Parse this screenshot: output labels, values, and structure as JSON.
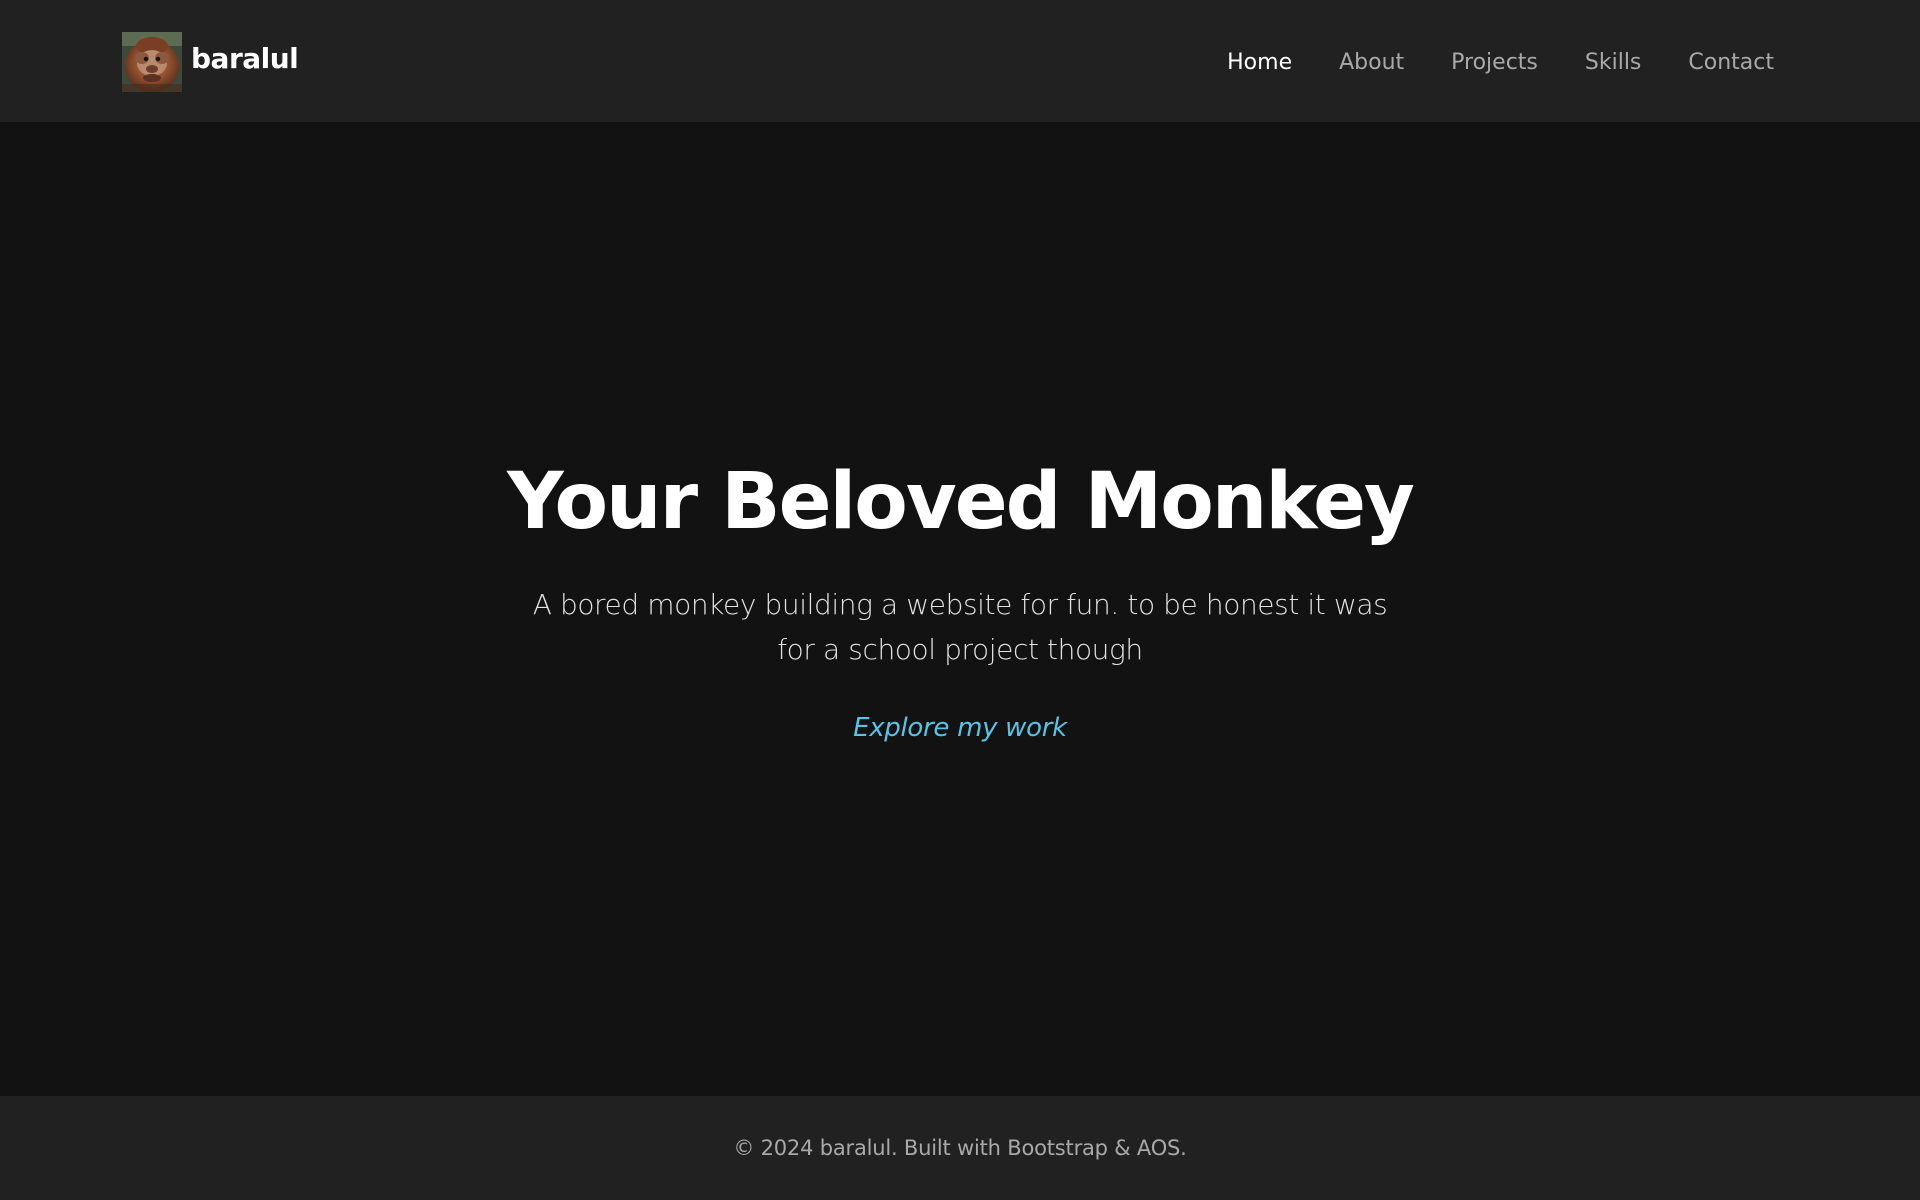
{
  "navbar": {
    "brand_name": "baralul",
    "logo_icon": "monkey-avatar-icon",
    "links": [
      {
        "label": "Home",
        "active": true
      },
      {
        "label": "About",
        "active": false
      },
      {
        "label": "Projects",
        "active": false
      },
      {
        "label": "Skills",
        "active": false
      },
      {
        "label": "Contact",
        "active": false
      }
    ]
  },
  "hero": {
    "title": "Your Beloved Monkey",
    "subtitle": "A bored monkey building a website for fun. to be honest it was for a school project though",
    "cta_label": "Explore my work"
  },
  "footer": {
    "text": "© 2024 baralul. Built with Bootstrap & AOS."
  },
  "colors": {
    "page_bg": "#121212",
    "bar_bg": "#212121",
    "accent": "#5bc2e7",
    "muted_text": "#a9a9a9"
  }
}
